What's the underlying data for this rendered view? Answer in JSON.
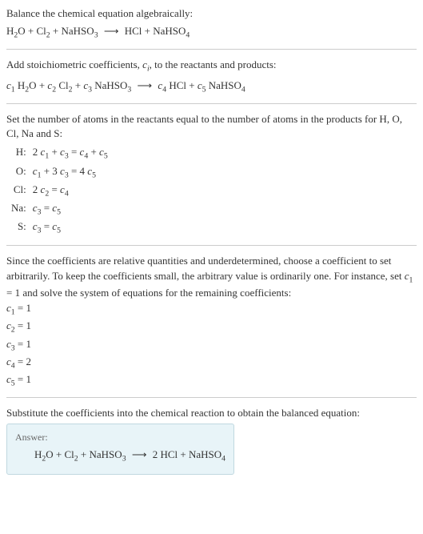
{
  "line1": "Balance the chemical equation algebraically:",
  "eq1": {
    "r1": "H",
    "r1s": "2",
    "r1b": "O",
    "r2": "Cl",
    "r2s": "2",
    "r3": "NaHSO",
    "r3s": "3",
    "p1": "HCl",
    "p2": "NaHSO",
    "p2s": "4"
  },
  "line2a": "Add stoichiometric coefficients, ",
  "line2b": ", to the reactants and products:",
  "ci_c": "c",
  "ci_i": "i",
  "coefEq": {
    "c1": "c",
    "c1s": "1",
    "sp1a": " H",
    "sp1s": "2",
    "sp1b": "O",
    "c2": "c",
    "c2s": "2",
    "sp2a": " Cl",
    "sp2s": "2",
    "c3": "c",
    "c3s": "3",
    "sp3a": " NaHSO",
    "sp3s": "3",
    "c4": "c",
    "c4s": "4",
    "sp4a": " HCl",
    "c5": "c",
    "c5s": "5",
    "sp5a": " NaHSO",
    "sp5s": "4"
  },
  "line3": "Set the number of atoms in the reactants equal to the number of atoms in the products for H, O, Cl, Na and S:",
  "balance": {
    "rows": [
      {
        "el": "H:",
        "lhs_a": "2 ",
        "c1": "c",
        "s1": "1",
        "mid": " + ",
        "c2": "c",
        "s2": "3",
        "eq": " = ",
        "c3": "c",
        "s3": "4",
        "mid2": " + ",
        "c4": "c",
        "s4": "5"
      },
      {
        "el": "O:",
        "c1": "c",
        "s1": "1",
        "mid": " + 3 ",
        "c2": "c",
        "s2": "3",
        "eq": " = 4 ",
        "c3": "c",
        "s3": "5"
      },
      {
        "el": "Cl:",
        "lhs_a": "2 ",
        "c1": "c",
        "s1": "2",
        "eq": " = ",
        "c3": "c",
        "s3": "4"
      },
      {
        "el": "Na:",
        "c1": "c",
        "s1": "3",
        "eq": " = ",
        "c3": "c",
        "s3": "5"
      },
      {
        "el": "S:",
        "c1": "c",
        "s1": "3",
        "eq": " = ",
        "c3": "c",
        "s3": "5"
      }
    ]
  },
  "line4a": "Since the coefficients are relative quantities and underdetermined, choose a coefficient to set arbitrarily. To keep the coefficients small, the arbitrary value is ordinarily one. For instance, set ",
  "line4b": " = 1 and solve the system of equations for the remaining coefficients:",
  "set_c": "c",
  "set_s": "1",
  "solutions": [
    {
      "c": "c",
      "s": "1",
      "v": " = 1"
    },
    {
      "c": "c",
      "s": "2",
      "v": " = 1"
    },
    {
      "c": "c",
      "s": "3",
      "v": " = 1"
    },
    {
      "c": "c",
      "s": "4",
      "v": " = 2"
    },
    {
      "c": "c",
      "s": "5",
      "v": " = 1"
    }
  ],
  "line5": "Substitute the coefficients into the chemical reaction to obtain the balanced equation:",
  "answer": {
    "label": "Answer:",
    "r1": "H",
    "r1s": "2",
    "r1b": "O",
    "r2": "Cl",
    "r2s": "2",
    "r3": "NaHSO",
    "r3s": "3",
    "p1a": "2 HCl",
    "p2": "NaHSO",
    "p2s": "4"
  },
  "plus": " + ",
  "arrow": "⟶"
}
